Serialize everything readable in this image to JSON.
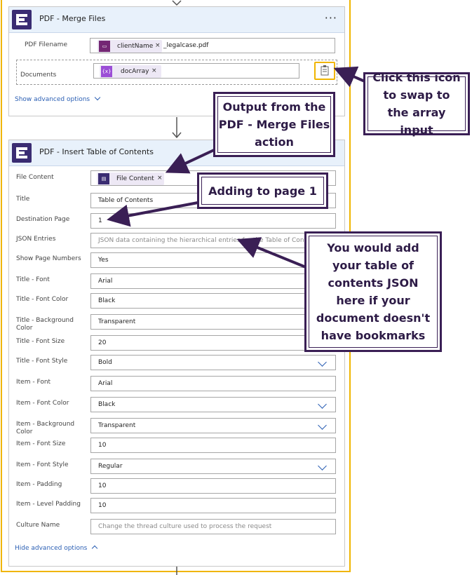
{
  "merge_card": {
    "title": "PDF - Merge Files",
    "more_label": "···",
    "filename_label": "PDF Filename",
    "filename_token": "clientName",
    "filename_suffix": "_legalcase.pdf",
    "documents_label": "Documents",
    "documents_token": "docArray",
    "documents_token_icon": "{x}",
    "show_advanced": "Show advanced options"
  },
  "toc_card": {
    "title": "PDF - Insert Table of Contents",
    "file_content_label": "File Content",
    "file_content_token": "File Content",
    "fields": [
      {
        "label": "Title",
        "value": "Table of Contents",
        "placeholder": "",
        "dropdown": false
      },
      {
        "label": "Destination Page",
        "value": "1",
        "placeholder": "",
        "dropdown": false
      },
      {
        "label": "JSON Entries",
        "value": "",
        "placeholder": "JSON data containing the hierarchical entries for the Table of Contents",
        "dropdown": false
      },
      {
        "label": "Show Page Numbers",
        "value": "Yes",
        "placeholder": "",
        "dropdown": false
      },
      {
        "label": "Title - Font",
        "value": "Arial",
        "placeholder": "",
        "dropdown": false
      },
      {
        "label": "Title - Font Color",
        "value": "Black",
        "placeholder": "",
        "dropdown": false
      },
      {
        "label": "Title - Background Color",
        "value": "Transparent",
        "placeholder": "",
        "dropdown": false
      },
      {
        "label": "Title - Font Size",
        "value": "20",
        "placeholder": "",
        "dropdown": false
      },
      {
        "label": "Title - Font Style",
        "value": "Bold",
        "placeholder": "",
        "dropdown": true
      },
      {
        "label": "Item - Font",
        "value": "Arial",
        "placeholder": "",
        "dropdown": false
      },
      {
        "label": "Item - Font Color",
        "value": "Black",
        "placeholder": "",
        "dropdown": true
      },
      {
        "label": "Item - Background Color",
        "value": "Transparent",
        "placeholder": "",
        "dropdown": true
      },
      {
        "label": "Item - Font Size",
        "value": "10",
        "placeholder": "",
        "dropdown": false
      },
      {
        "label": "Item - Font Style",
        "value": "Regular",
        "placeholder": "",
        "dropdown": true
      },
      {
        "label": "Item - Padding",
        "value": "10",
        "placeholder": "",
        "dropdown": false
      },
      {
        "label": "Item - Level Padding",
        "value": "10",
        "placeholder": "",
        "dropdown": false
      },
      {
        "label": "Culture Name",
        "value": "",
        "placeholder": "Change the thread culture used to process the request",
        "dropdown": false
      }
    ],
    "hide_advanced": "Hide advanced options"
  },
  "callouts": {
    "swap_icon": "Click this icon to swap to the array input",
    "output_from": "Output from the PDF - Merge Files action",
    "adding_page": "Adding to page 1",
    "json_note": "You would add your table of contents JSON here if your document doesn't have bookmarks"
  },
  "colors": {
    "frame": "#f0b500",
    "header_bg": "#e8f1fb",
    "accent": "#2b5fb4",
    "callout_border": "#3a1f55",
    "token_purple": "#742774",
    "variable_purple": "#9b4dd6",
    "logo": "#3a2c72"
  },
  "icons": {
    "swap": "array-swap-icon",
    "variable": "variable-icon",
    "expression": "expression-icon"
  }
}
